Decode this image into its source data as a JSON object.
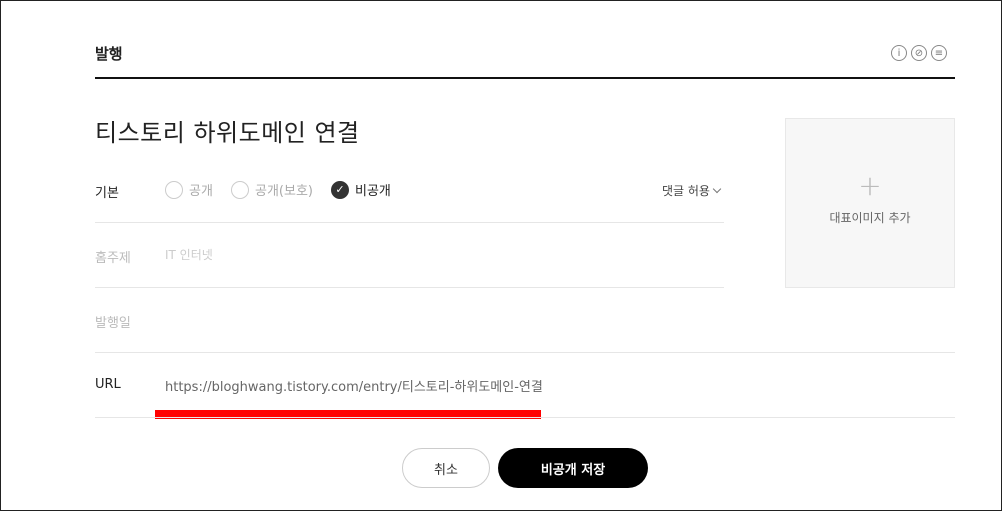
{
  "header": {
    "title": "발행",
    "icons": [
      "accessibility-icon",
      "no-edit-icon",
      "menu-icon"
    ]
  },
  "post": {
    "title": "티스토리 하위도메인 연결"
  },
  "basic": {
    "label": "기본",
    "options": [
      {
        "label": "공개",
        "checked": false
      },
      {
        "label": "공개(보호)",
        "checked": false
      },
      {
        "label": "비공개",
        "checked": true
      }
    ],
    "comment_setting": "댓글 허용"
  },
  "topic": {
    "label": "홈주제",
    "value": "IT 인터넷"
  },
  "publish_date": {
    "label": "발행일"
  },
  "url": {
    "label": "URL",
    "value": "https://bloghwang.tistory.com/entry/티스토리-하위도메인-연결",
    "highlight_color": "#ff0000"
  },
  "thumbnail": {
    "plus": "+",
    "label": "대표이미지 추가"
  },
  "actions": {
    "cancel": "취소",
    "save": "비공개 저장"
  }
}
